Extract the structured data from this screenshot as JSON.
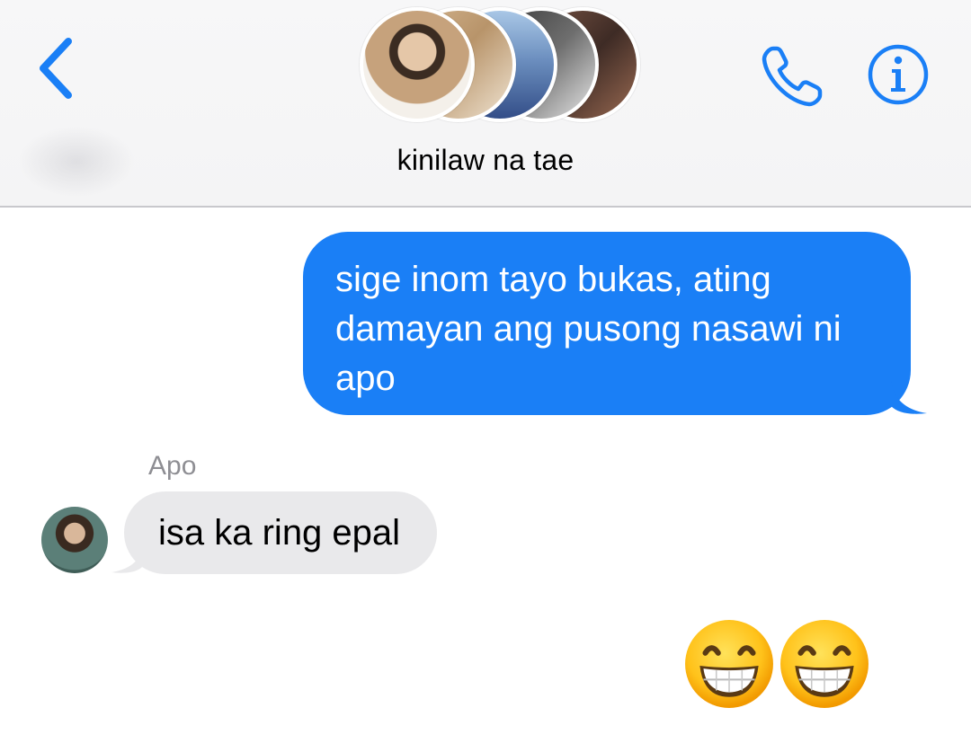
{
  "header": {
    "back_icon": "chevron-left-icon",
    "group_name": "kinilaw na tae",
    "call_icon": "phone-icon",
    "info_icon": "info-icon",
    "accent_color": "#1a7ff6"
  },
  "messages": [
    {
      "direction": "outgoing",
      "text": "sige inom tayo bukas, ating damayan ang pusong nasawi ni apo"
    },
    {
      "direction": "incoming",
      "sender": "Apo",
      "text": "isa ka ring epal"
    },
    {
      "direction": "outgoing",
      "emoji": "😁😁"
    }
  ]
}
